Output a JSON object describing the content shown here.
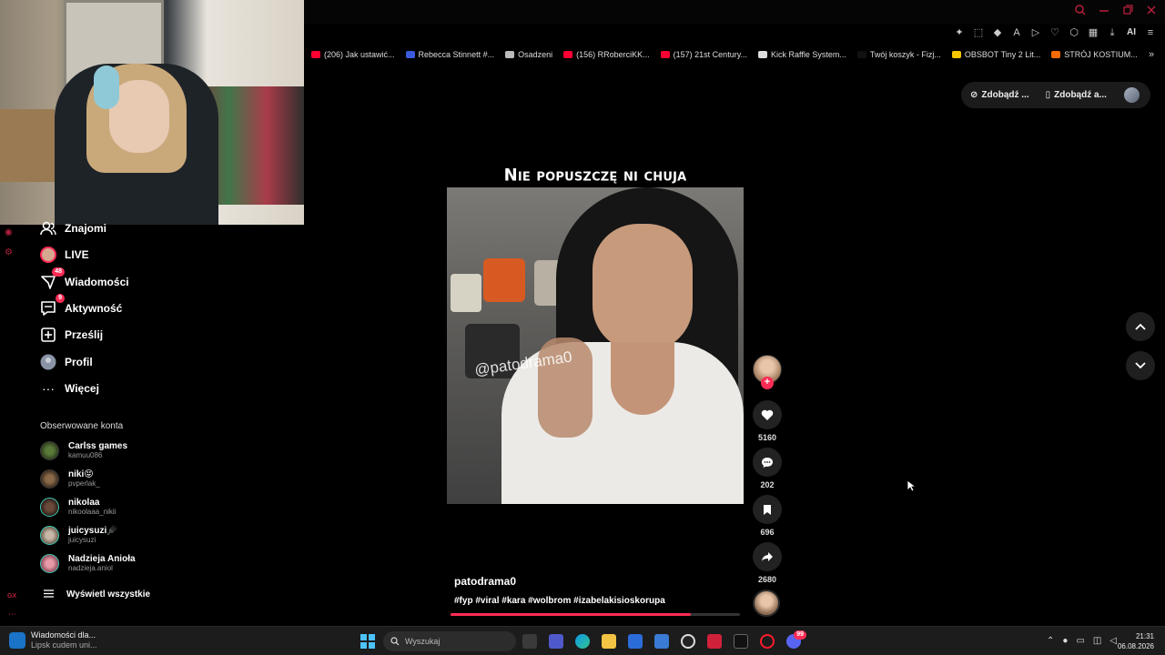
{
  "bookmarks": [
    {
      "label": "(206) Jak ustawić...",
      "color": "#ff0033"
    },
    {
      "label": "Rebecca Stinnett #...",
      "color": "#3b5bdb"
    },
    {
      "label": "Osadzeni",
      "color": "#bbbbbb"
    },
    {
      "label": "(156) RRoberciKK...",
      "color": "#ff0033"
    },
    {
      "label": "(157) 21st Century...",
      "color": "#ff0033"
    },
    {
      "label": "Kick Raffle System...",
      "color": "#dddddd"
    },
    {
      "label": "Twój koszyk - Fizj...",
      "color": "#111111"
    },
    {
      "label": "OBSBOT Tiny 2 Lit...",
      "color": "#f7c600"
    },
    {
      "label": "STRÓJ KOSTIUM...",
      "color": "#ff6a00"
    }
  ],
  "header": {
    "get_coins": "Zdobądź ...",
    "get_app": "Zdobądź a..."
  },
  "sidebar": {
    "items": [
      {
        "label": "Znajomi",
        "icon": "friends-icon"
      },
      {
        "label": "LIVE",
        "icon": "live-icon"
      },
      {
        "label": "Wiadomości",
        "icon": "messages-icon",
        "badge": "48"
      },
      {
        "label": "Aktywność",
        "icon": "activity-icon",
        "badge": "9"
      },
      {
        "label": "Prześlij",
        "icon": "upload-icon"
      },
      {
        "label": "Profil",
        "icon": "profile-icon"
      },
      {
        "label": "Więcej",
        "icon": "more-icon"
      }
    ],
    "followed_title": "Obserwowane konta",
    "accounts": [
      {
        "name": "Carlss games",
        "handle": "kamuu086"
      },
      {
        "name": "niki😝",
        "handle": "pvperlak_"
      },
      {
        "name": "nikolaa",
        "handle": "nikoolaaa_nikii"
      },
      {
        "name": "juicysuzi🪮",
        "handle": "juicysuzi"
      },
      {
        "name": "Nadzieja Anioła",
        "handle": "nadzieja.aniol"
      }
    ],
    "see_all": "Wyświetl wszystkie",
    "rail_label": "GX"
  },
  "video": {
    "title": "Nie popuszczę ni chuja",
    "watermark": "@patodrama0",
    "author": "patodrama0",
    "hashtags": "#fyp #viral #kara #wolbrom #izabelakisioskorupa",
    "progress": 0.83,
    "likes": "5160",
    "comments": "202",
    "saves": "696",
    "shares": "2680"
  },
  "taskbar": {
    "news_title": "Wiadomości dla...",
    "news_sub": "Lipsk cudem uni...",
    "search_placeholder": "Wyszukaj",
    "time": "21:31",
    "date": "06.08.2026",
    "discord_badge": "99"
  },
  "colors": {
    "accent": "#fe2c55",
    "opera_red": "#b41f3c",
    "windows_blue": "#4cc2ff"
  }
}
